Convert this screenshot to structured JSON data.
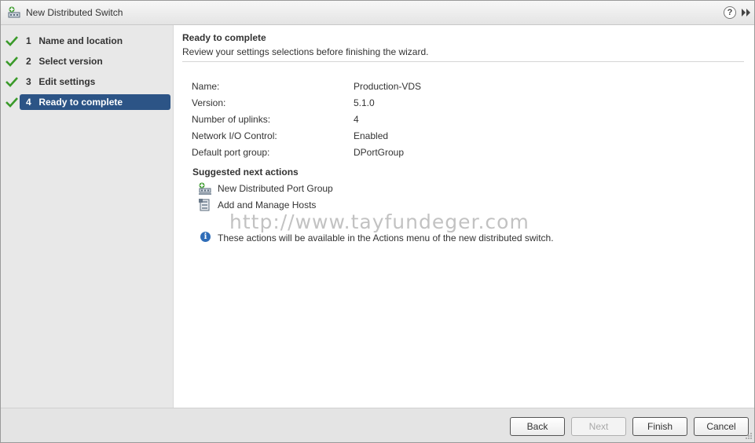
{
  "window": {
    "title": "New Distributed Switch",
    "help_label": "?",
    "icons": {
      "title": "distributed-switch-icon",
      "help": "help-icon",
      "expand": "expand-icon"
    }
  },
  "steps": [
    {
      "num": "1",
      "label": "Name and location",
      "done": true,
      "active": false
    },
    {
      "num": "2",
      "label": "Select version",
      "done": true,
      "active": false
    },
    {
      "num": "3",
      "label": "Edit settings",
      "done": true,
      "active": false
    },
    {
      "num": "4",
      "label": "Ready to complete",
      "done": true,
      "active": true
    }
  ],
  "content": {
    "title": "Ready to complete",
    "subtitle": "Review your settings selections before finishing the wizard.",
    "settings": [
      {
        "label": "Name:",
        "value": "Production-VDS"
      },
      {
        "label": "Version:",
        "value": "5.1.0"
      },
      {
        "label": "Number of uplinks:",
        "value": "4"
      },
      {
        "label": "Network I/O Control:",
        "value": "Enabled"
      },
      {
        "label": "Default port group:",
        "value": "DPortGroup"
      }
    ],
    "suggested_title": "Suggested next actions",
    "actions": [
      {
        "label": "New Distributed Port Group",
        "icon": "new-port-group-icon"
      },
      {
        "label": "Add and Manage Hosts",
        "icon": "add-hosts-icon"
      }
    ],
    "info_icon_glyph": "i",
    "info_text": "These actions will be available in the Actions menu of the new distributed switch.",
    "watermark": "http://www.tayfundeger.com"
  },
  "footer": {
    "back": "Back",
    "next": "Next",
    "finish": "Finish",
    "cancel": "Cancel"
  },
  "colors": {
    "active_step": "#2c5486",
    "check": "#3a9a2a",
    "info": "#2f6db8"
  }
}
